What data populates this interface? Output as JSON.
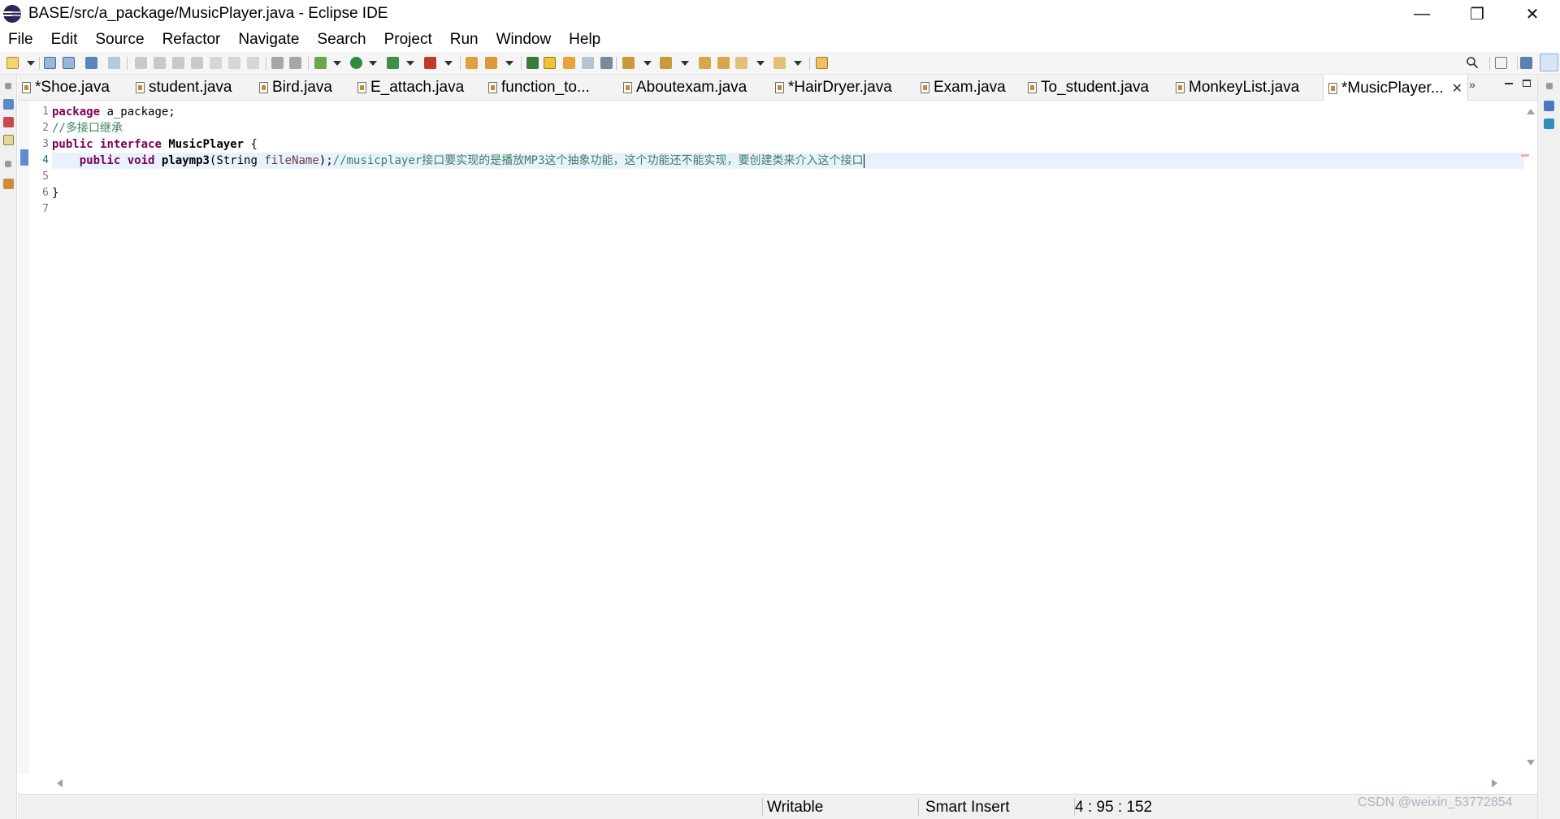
{
  "window": {
    "title": "BASE/src/a_package/MusicPlayer.java - Eclipse IDE",
    "controls": [
      "—",
      "❐",
      "✕"
    ]
  },
  "menu": [
    "File",
    "Edit",
    "Source",
    "Refactor",
    "Navigate",
    "Search",
    "Project",
    "Run",
    "Window",
    "Help"
  ],
  "tabs": [
    {
      "label": "*Shoe.java"
    },
    {
      "label": "student.java"
    },
    {
      "label": "Bird.java"
    },
    {
      "label": "E_attach.java"
    },
    {
      "label": "function_to..."
    },
    {
      "label": "Aboutexam.java"
    },
    {
      "label": "*HairDryer.java"
    },
    {
      "label": "Exam.java"
    },
    {
      "label": "To_student.java"
    },
    {
      "label": "MonkeyList.java"
    },
    {
      "label": "*MusicPlayer...",
      "active": true
    }
  ],
  "tab_close": "✕",
  "tab_overflow": "»",
  "editor": {
    "line_numbers": [
      "1",
      "2",
      "3",
      "4",
      "5",
      "6",
      "7"
    ],
    "current_line": 4,
    "lines": {
      "l1_kw": "package",
      "l1_rest": " a_package;",
      "l2_comment": "//多接口继承",
      "l3_kw1": "public",
      "l3_kw2": "interface",
      "l3_name": "MusicPlayer",
      "l3_rest": " {",
      "l4_indent": "    ",
      "l4_kw1": "public",
      "l4_kw2": "void",
      "l4_method": "playmp3",
      "l4_params_open": "(String ",
      "l4_param": "fileName",
      "l4_params_close": ");",
      "l4_comment": "//musicplayer接口要实现的是播放MP3这个抽象功能，这个功能还不能实现，要创建类来介入这个接口",
      "l6_brace": "}"
    }
  },
  "status": {
    "writable": "Writable",
    "insert_mode": "Smart Insert",
    "position": "4 : 95 : 152"
  },
  "watermark": "CSDN @weixin_53772854"
}
